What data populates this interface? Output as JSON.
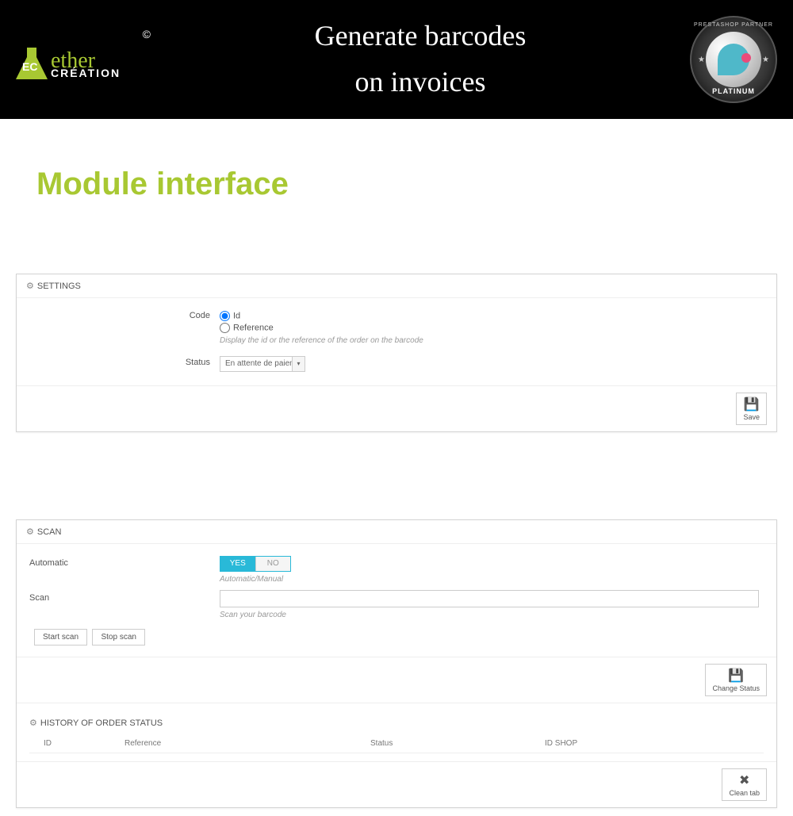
{
  "header": {
    "logo": {
      "brand_top": "ether",
      "brand_bottom": "CRÉATION",
      "badge": "EC",
      "copyright": "©"
    },
    "title_line1": "Generate barcodes",
    "title_line2": "on invoices",
    "partner": {
      "top": "PRESTASHOP PARTNER",
      "bottom": "PLATINUM"
    }
  },
  "section_title": "Module interface",
  "settings": {
    "heading": "SETTINGS",
    "code_label": "Code",
    "code_options": {
      "id": "Id",
      "reference": "Reference"
    },
    "code_help": "Display the id or the reference of the order on the barcode",
    "status_label": "Status",
    "status_value": "En attente de paiement par c",
    "save_label": "Save"
  },
  "scan": {
    "heading": "SCAN",
    "automatic_label": "Automatic",
    "toggle_yes": "YES",
    "toggle_no": "NO",
    "automatic_help": "Automatic/Manual",
    "scan_label": "Scan",
    "scan_help": "Scan your barcode",
    "start_scan": "Start scan",
    "stop_scan": "Stop scan",
    "change_status": "Change Status"
  },
  "history": {
    "heading": "HISTORY OF ORDER STATUS",
    "columns": {
      "id": "ID",
      "reference": "Reference",
      "status": "Status",
      "id_shop": "ID SHOP"
    },
    "clean_tab": "Clean tab"
  }
}
